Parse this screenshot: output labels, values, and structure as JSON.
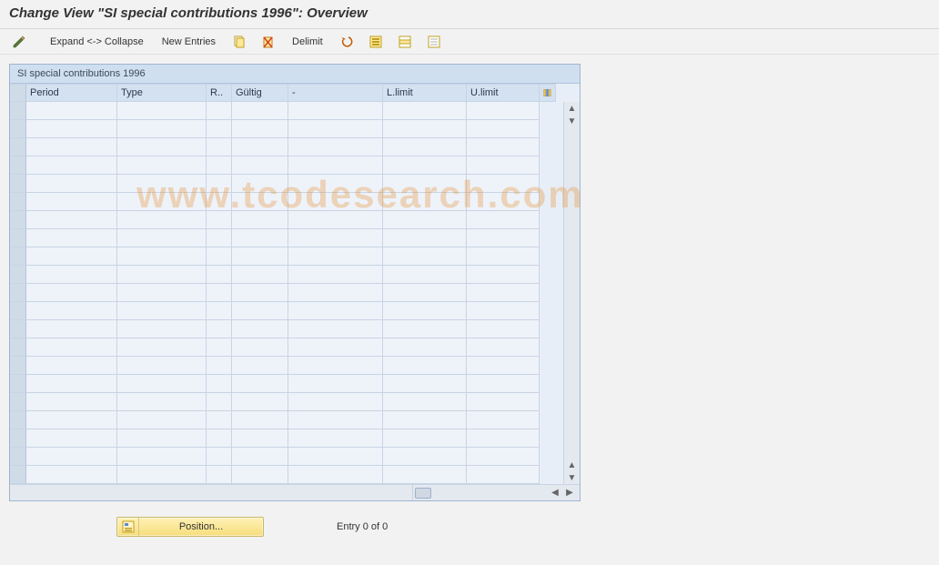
{
  "title": "Change View \"SI special contributions 1996\": Overview",
  "toolbar": {
    "expand_collapse": "Expand <-> Collapse",
    "new_entries": "New Entries",
    "delimit": "Delimit"
  },
  "panel": {
    "title": "SI special contributions 1996",
    "columns": {
      "period": "Period",
      "type": "Type",
      "r": "R..",
      "gultig": "Gültig",
      "dash": "-",
      "llimit": "L.limit",
      "ulimit": "U.limit"
    },
    "rows": [
      {},
      {},
      {},
      {},
      {},
      {},
      {},
      {},
      {},
      {},
      {},
      {},
      {},
      {},
      {},
      {},
      {},
      {},
      {},
      {},
      {}
    ]
  },
  "footer": {
    "position_label": "Position...",
    "entry_text": "Entry 0 of 0"
  },
  "watermark": "www.tcodesearch.com"
}
